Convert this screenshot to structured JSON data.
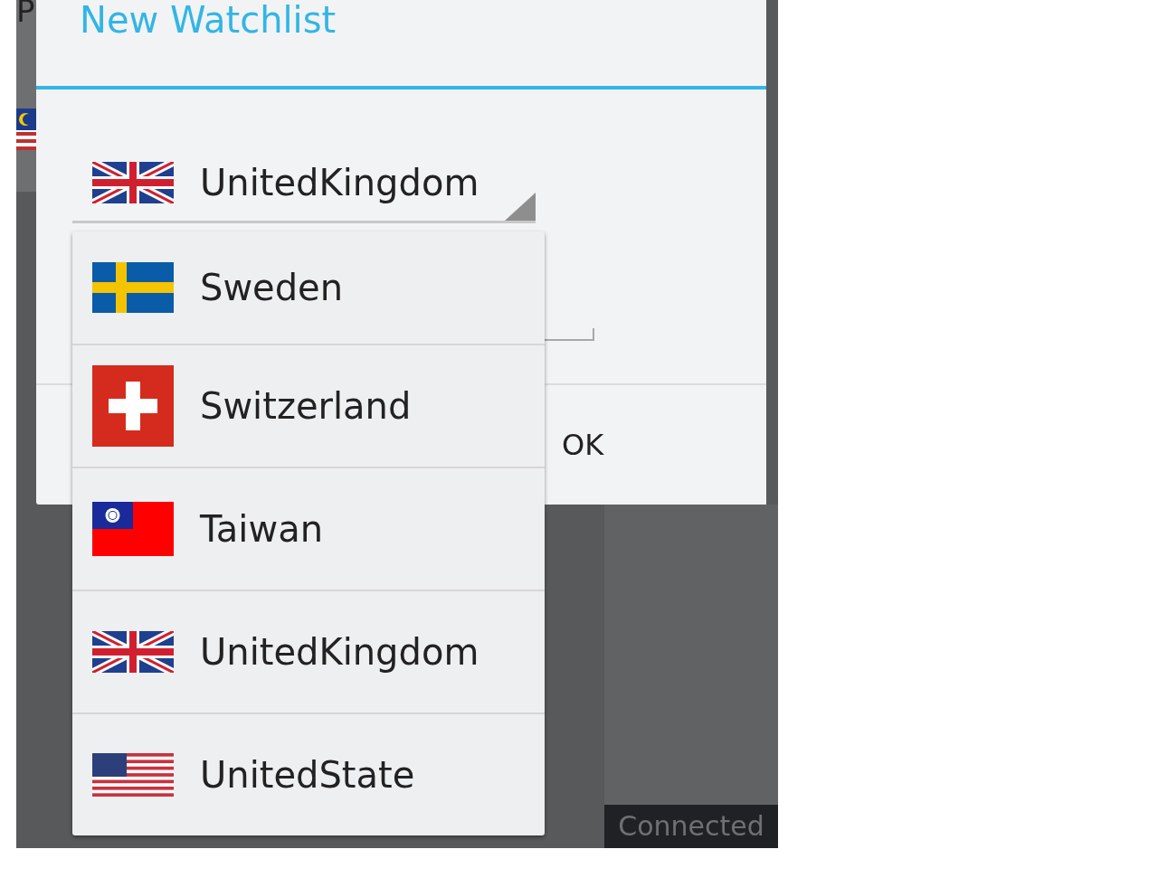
{
  "background": {
    "heading_fragment": "P",
    "status": "Connected"
  },
  "dialog": {
    "title": "New Watchlist",
    "spinner": {
      "value": "UnitedKingdom",
      "kind": "gb"
    },
    "buttons": [
      {
        "label": "OK"
      }
    ]
  },
  "dropdown": {
    "items": [
      {
        "label": "Sweden",
        "kind": "se"
      },
      {
        "label": "Switzerland",
        "kind": "ch"
      },
      {
        "label": "Taiwan",
        "kind": "tw"
      },
      {
        "label": "UnitedKingdom",
        "kind": "gb"
      },
      {
        "label": "UnitedState",
        "kind": "us"
      }
    ]
  }
}
